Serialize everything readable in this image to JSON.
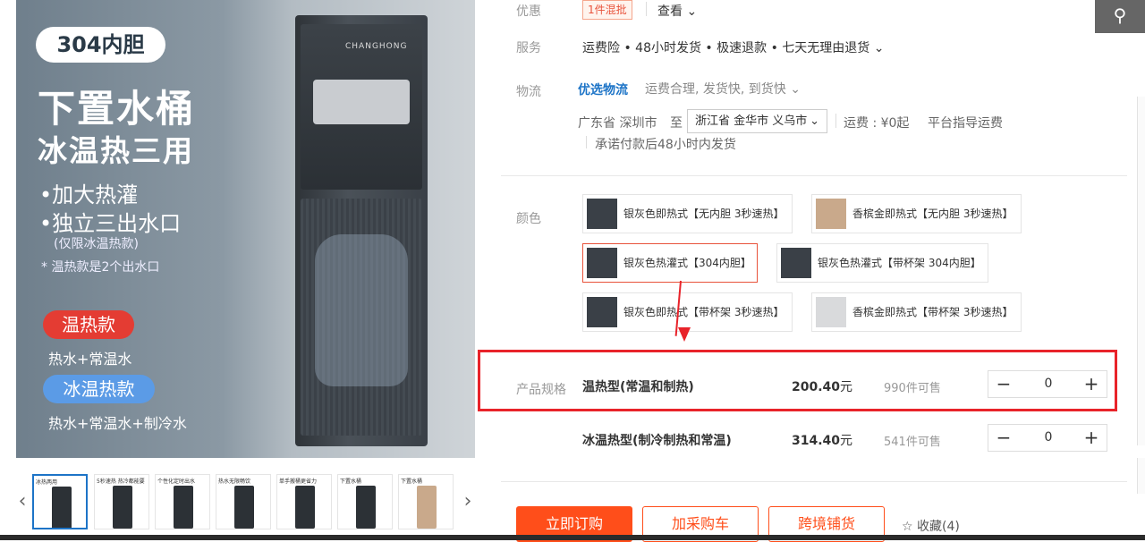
{
  "gallery": {
    "pill": "304内胆",
    "headline": "下置水桶",
    "subhead": "冰温热三用",
    "bullets": [
      "•加大热灌",
      "•独立三出水口"
    ],
    "bullet_note": "(仅限冰温热款)",
    "note": "* 温热款是2个出水口",
    "tag_warm": "温热款",
    "tag_warm_desc": "热水+常温水",
    "tag_cold": "冰温热款",
    "tag_cold_desc": "热水+常温水+制冷水",
    "brand": "CHANGHONG",
    "prev_icon": "‹",
    "next_icon": "›",
    "thumbs": [
      {
        "text": "冰热两用"
      },
      {
        "text": "5秒速热 热冷都能要"
      },
      {
        "text": "个性化定时出水"
      },
      {
        "text": "热水无限畅饮"
      },
      {
        "text": "单手搬桶更省力"
      },
      {
        "text": "下置水桶"
      },
      {
        "text": "下置水桶"
      }
    ]
  },
  "promo": {
    "label": "优惠",
    "badge": "1件混批",
    "view": "查看"
  },
  "service": {
    "label": "服务",
    "text": "运费险 • 48小时发货 • 极速退款 • 七天无理由退货"
  },
  "logistics": {
    "label": "物流",
    "brand": "优选物流",
    "desc": "运费合理, 发货快, 到货快",
    "from": "广东省 深圳市",
    "to_label": "至",
    "to_value": "浙江省 金华市 义乌市",
    "freight": "运费 : ¥0起",
    "platform": "平台指导运费",
    "promise": "承诺付款后48小时内发货"
  },
  "color": {
    "label": "颜色",
    "options": [
      "银灰色即热式【无内胆 3秒速热】",
      "香槟金即热式【无内胆 3秒速热】",
      "银灰色热灌式【304内胆】",
      "银灰色热灌式【带杯架 304内胆】",
      "银灰色即热式【带杯架 3秒速热】",
      "香槟金即热式【带杯架 3秒速热】"
    ],
    "selected_index": 2
  },
  "spec": {
    "label": "产品规格",
    "items": [
      {
        "name": "温热型(常温和制热)",
        "price": "200.40",
        "unit": "元",
        "stock": "990件可售",
        "qty": "0"
      },
      {
        "name": "冰温热型(制冷制热和常温)",
        "price": "314.40",
        "unit": "元",
        "stock": "541件可售",
        "qty": "0"
      }
    ],
    "minus": "−",
    "plus": "+"
  },
  "actions": {
    "order": "立即订购",
    "cart": "加采购车",
    "cross": "跨境铺货",
    "fav": "☆ 收藏(4)"
  },
  "search": {
    "icon": "search-icon"
  },
  "colors": {
    "accent": "#ff4e1a",
    "highlight_box": "#e8232a",
    "link": "#1d74c7"
  }
}
